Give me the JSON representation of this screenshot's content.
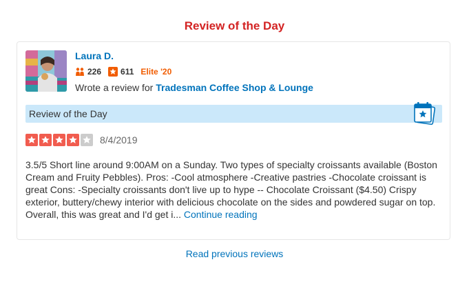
{
  "section": {
    "title": "Review of the Day"
  },
  "review": {
    "user": {
      "name": "Laura D.",
      "friends_count": "226",
      "reviews_count": "611",
      "elite_badge": "Elite '20"
    },
    "wrote_prefix": "Wrote a review for ",
    "business_name": "Tradesman Coffee Shop & Lounge",
    "banner_label": "Review of the Day",
    "rating": 4,
    "rating_max": 5,
    "date": "8/4/2019",
    "text": "3.5/5 Short line around 9:00AM on a Sunday. Two types of specialty croissants available (Boston Cream and Fruity Pebbles). Pros: -Cool atmosphere -Creative pastries -Chocolate croissant is great Cons: -Specialty croissants don't live up to hype -- Chocolate Croissant ($4.50) Crispy exterior, buttery/chewy interior with delicious chocolate on the sides and powdered sugar on top. Overall, this was great and I'd get i...",
    "continue_label": "Continue reading"
  },
  "footer": {
    "read_previous_label": "Read previous reviews"
  },
  "colors": {
    "brand_red": "#d32323",
    "link_blue": "#0073bb",
    "elite_orange": "#f15c00",
    "banner_blue": "#cbe8fa",
    "star_red": "#f15c4f",
    "star_gray": "#cccccc"
  },
  "icons": {
    "friends": "friends-icon",
    "reviews": "reviews-star-icon",
    "banner": "calendar-star-icon",
    "rating_star": "star-icon"
  }
}
